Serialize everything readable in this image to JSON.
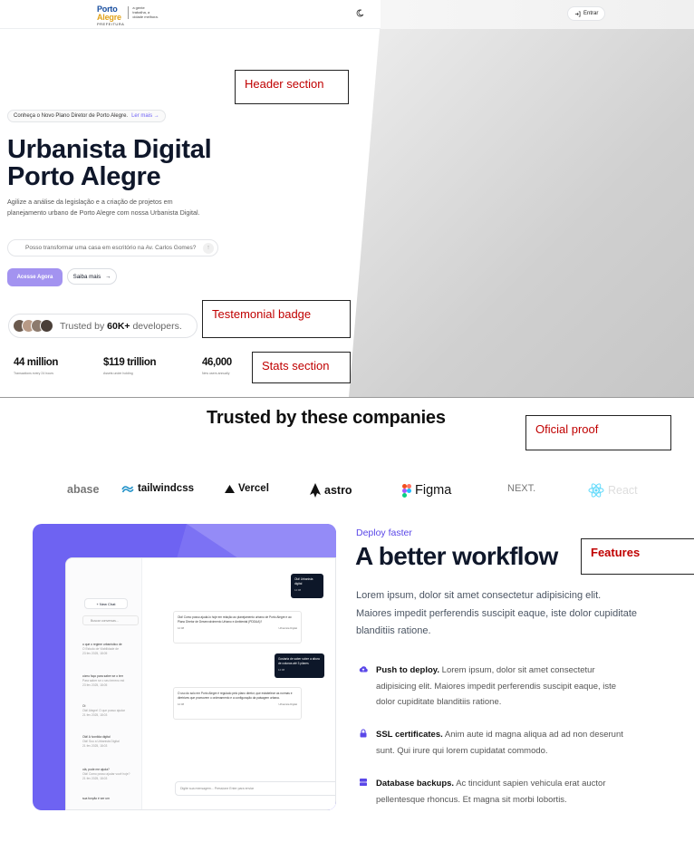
{
  "nav": {
    "logo_line1": "Porto",
    "logo_line2": "Alegre",
    "logo_sub": "PREFEITURA",
    "logo_tag": "a gente trabalha, a cidade melhora.",
    "enter_label": "Entrar"
  },
  "hero": {
    "pill_text": "Conheça o Novo Plano Diretor de Porto Alegre.",
    "pill_link": "Ler mais",
    "title_line1": "Urbanista Digital",
    "title_line2": "Porto Alegre",
    "description": "Agilize a análise da legislação e a criação de projetos em planejamento urbano de Porto Alegre com nossa Urbanista Digital.",
    "search_placeholder": "Posso transformar uma casa em escritório na Av. Carlos Gomes?",
    "primary_button": "Acesse Agora",
    "secondary_button": "Saiba mais"
  },
  "badge": {
    "prefix": "Trusted by ",
    "count": "60K+",
    "suffix": " developers."
  },
  "stats": [
    {
      "value": "44 million",
      "label": "Transactions every 24 hours"
    },
    {
      "value": "$119 trillion",
      "label": "Assets under holding"
    },
    {
      "value": "46,000",
      "label": "New users annually"
    }
  ],
  "annotations": {
    "header": "Header section",
    "badge": "Testemonial badge",
    "stats": "Stats section",
    "proof": "Oficial proof",
    "features": "Features"
  },
  "trusted": {
    "title": "Trusted by these companies",
    "logos": [
      "abase",
      "tailwindcss",
      "Vercel",
      "astro",
      "Figma",
      "NEXT.",
      "React"
    ]
  },
  "mock": {
    "new_chat": "+ New Chat",
    "search": "Buscar conversas...",
    "chats": [
      {
        "title": "o que o regime urbanístico de",
        "sub": "O Estudo de Viabilidade de",
        "date": "23 fev 2025, 18:05"
      },
      {
        "title": "cómo faço para saber se o terr",
        "sub": "Para saber se o seu terreno est",
        "date": "23 fev 2025, 18:05"
      },
      {
        "title": "Oi",
        "sub": "Olá! Alegre! O que posso ajudar",
        "date": "21 fev 2025, 18:03"
      },
      {
        "title": "Olá! A Ivonilda digital",
        "sub": "Olá! Sou a Urbanista Digital",
        "date": "21 fev 2025, 18:03"
      },
      {
        "title": "olá, pode me ajuda?",
        "sub": "Olá! Como posso ajudar você hoje?",
        "date": "21 fev 2025, 18:03"
      },
      {
        "title": "sua função é ser um",
        "sub": "",
        "date": ""
      }
    ],
    "msg1": "Olá! Urbanista digital",
    "msg2": "Olá! Como posso ajudá-lo hoje em relação ao planejamento urbano de Porto Alegre e ao Plano Diretor de Desenvolvimento Urbano e Ambiental (PDDUA)?",
    "msg3": "Gostaria de saber sobre a altura de colunas até 3 pilares",
    "msg4": "O uso do solo em Porto Alegre é regulado pelo plano diretor, que estabelece as normas e diretrizes que promovem o ordenamento e a configuração da paisagem urbana.",
    "sender": "Urbanista Digital",
    "time": "12:08",
    "composer": "Digite sua mensagem... Pressione Enter para enviar"
  },
  "features": {
    "kicker": "Deploy faster",
    "title": "A better workflow",
    "description": "Lorem ipsum, dolor sit amet consectetur adipisicing elit. Maiores impedit perferendis suscipit eaque, iste dolor cupiditate blanditiis ratione.",
    "items": [
      {
        "name": "Push to deploy.",
        "text": " Lorem ipsum, dolor sit amet consectetur adipisicing elit. Maiores impedit perferendis suscipit eaque, iste dolor cupiditate blanditiis ratione."
      },
      {
        "name": "SSL certificates.",
        "text": " Anim aute id magna aliqua ad ad non deserunt sunt. Qui irure qui lorem cupidatat commodo."
      },
      {
        "name": "Database backups.",
        "text": " Ac tincidunt sapien vehicula erat auctor pellentesque rhoncus. Et magna sit morbi lobortis."
      }
    ]
  },
  "colors": {
    "accent": "#6d5ff5",
    "primary_button": "#a393f0",
    "annotation": "#c00000"
  }
}
